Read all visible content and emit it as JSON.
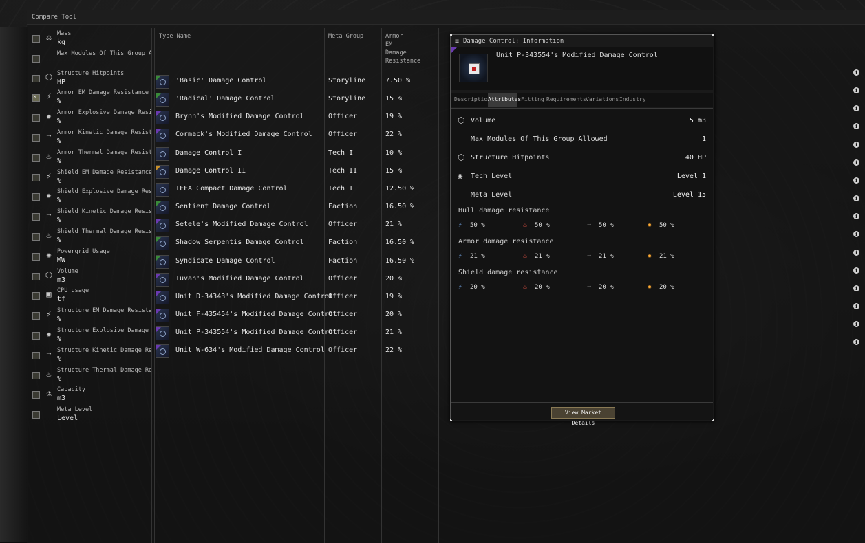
{
  "window_title": "Compare Tool",
  "attributes": [
    {
      "name": "Mass",
      "unit": "kg",
      "icon": "mass-icon",
      "glyph": "⚖",
      "checked": false
    },
    {
      "name": "Max Modules Of This Group Allowed",
      "unit": "",
      "icon": "none",
      "glyph": "",
      "checked": false
    },
    {
      "name": "Structure Hitpoints",
      "unit": "HP",
      "icon": "structure-cube-icon",
      "glyph": "⬡",
      "checked": false
    },
    {
      "name": "Armor EM Damage Resistance",
      "unit": "%",
      "icon": "em-resist-icon",
      "glyph": "⚡",
      "checked": true
    },
    {
      "name": "Armor Explosive Damage Resista",
      "unit": "%",
      "icon": "explosive-resist-icon",
      "glyph": "✹",
      "checked": false
    },
    {
      "name": "Armor Kinetic Damage Resistance",
      "unit": "%",
      "icon": "kinetic-resist-icon",
      "glyph": "➝",
      "checked": false
    },
    {
      "name": "Armor Thermal Damage Resistar",
      "unit": "%",
      "icon": "thermal-resist-icon",
      "glyph": "♨",
      "checked": false
    },
    {
      "name": "Shield EM Damage Resistance",
      "unit": "%",
      "icon": "em-resist-icon",
      "glyph": "⚡",
      "checked": false
    },
    {
      "name": "Shield Explosive Damage Resista",
      "unit": "%",
      "icon": "explosive-resist-icon",
      "glyph": "✹",
      "checked": false
    },
    {
      "name": "Shield Kinetic Damage Resistance",
      "unit": "%",
      "icon": "kinetic-resist-icon",
      "glyph": "➝",
      "checked": false
    },
    {
      "name": "Shield Thermal Damage Resistar",
      "unit": "%",
      "icon": "thermal-resist-icon",
      "glyph": "♨",
      "checked": false
    },
    {
      "name": "Powergrid Usage",
      "unit": "MW",
      "icon": "powergrid-icon",
      "glyph": "✺",
      "checked": false
    },
    {
      "name": "Volume",
      "unit": "m3",
      "icon": "volume-cube-icon",
      "glyph": "⬡",
      "checked": false
    },
    {
      "name": "CPU usage",
      "unit": "tf",
      "icon": "cpu-icon",
      "glyph": "▣",
      "checked": false
    },
    {
      "name": "Structure EM Damage Resistance",
      "unit": "%",
      "icon": "em-resist-icon",
      "glyph": "⚡",
      "checked": false
    },
    {
      "name": "Structure Explosive Damage Resi",
      "unit": "%",
      "icon": "explosive-resist-icon",
      "glyph": "✹",
      "checked": false
    },
    {
      "name": "Structure Kinetic Damage Resist",
      "unit": "%",
      "icon": "kinetic-resist-icon",
      "glyph": "➝",
      "checked": false
    },
    {
      "name": "Structure Thermal Damage Resis",
      "unit": "%",
      "icon": "thermal-resist-icon",
      "glyph": "♨",
      "checked": false
    },
    {
      "name": "Capacity",
      "unit": "m3",
      "icon": "capacity-icon",
      "glyph": "⚗",
      "checked": false
    },
    {
      "name": "Meta Level",
      "unit": "Level",
      "icon": "none",
      "glyph": "",
      "checked": false
    }
  ],
  "columns": {
    "type_name": "Type Name",
    "meta_group": "Meta Group",
    "armor_em": [
      "Armor",
      "EM",
      "Damage",
      "Resistance"
    ]
  },
  "items": [
    {
      "name": "'Basic' Damage Control",
      "meta": "Storyline",
      "value": "7.50 %",
      "tag": "#3a8a3a"
    },
    {
      "name": "'Radical' Damage Control",
      "meta": "Storyline",
      "value": "15 %",
      "tag": "#3a8a3a"
    },
    {
      "name": "Brynn's Modified Damage Control",
      "meta": "Officer",
      "value": "19 %",
      "tag": "#6a3ab0"
    },
    {
      "name": "Cormack's Modified Damage Control",
      "meta": "Officer",
      "value": "22 %",
      "tag": "#6a3ab0"
    },
    {
      "name": "Damage Control I",
      "meta": "Tech I",
      "value": "10 %",
      "tag": ""
    },
    {
      "name": "Damage Control II",
      "meta": "Tech II",
      "value": "15 %",
      "tag": "#c8902a"
    },
    {
      "name": "IFFA Compact Damage Control",
      "meta": "Tech I",
      "value": "12.50 %",
      "tag": ""
    },
    {
      "name": "Sentient Damage Control",
      "meta": "Faction",
      "value": "16.50 %",
      "tag": "#3a8a3a"
    },
    {
      "name": "Setele's Modified Damage Control",
      "meta": "Officer",
      "value": "21 %",
      "tag": "#6a3ab0"
    },
    {
      "name": "Shadow Serpentis Damage Control",
      "meta": "Faction",
      "value": "16.50 %",
      "tag": "#3a8a3a"
    },
    {
      "name": "Syndicate Damage Control",
      "meta": "Faction",
      "value": "16.50 %",
      "tag": "#3a8a3a"
    },
    {
      "name": "Tuvan's Modified Damage Control",
      "meta": "Officer",
      "value": "20 %",
      "tag": "#6a3ab0"
    },
    {
      "name": "Unit D-34343's Modified Damage Control",
      "meta": "Officer",
      "value": "19 %",
      "tag": "#6a3ab0"
    },
    {
      "name": "Unit F-435454's Modified Damage Control",
      "meta": "Officer",
      "value": "20 %",
      "tag": "#6a3ab0"
    },
    {
      "name": "Unit P-343554's Modified Damage Control",
      "meta": "Officer",
      "value": "21 %",
      "tag": "#6a3ab0"
    },
    {
      "name": "Unit W-634's Modified Damage Control",
      "meta": "Officer",
      "value": "22 %",
      "tag": "#6a3ab0"
    }
  ],
  "info_icon_glyph": "i",
  "info_window": {
    "title": "Damage Control: Information",
    "item_name": "Unit P-343554's Modified Damage Control",
    "tabs": [
      "Description",
      "Attributes",
      "Fitting",
      "Requirements",
      "Variations",
      "Industry"
    ],
    "active_tab": "Attributes",
    "attributes": [
      {
        "label": "Volume",
        "value": "5 m3",
        "icon": "volume-cube-icon",
        "glyph": "⬡"
      },
      {
        "label": "Max Modules Of This Group Allowed",
        "value": "1",
        "icon": "none",
        "glyph": ""
      },
      {
        "label": "Structure Hitpoints",
        "value": "40 HP",
        "icon": "structure-cube-icon",
        "glyph": "⬡"
      },
      {
        "label": "Tech Level",
        "value": "Level 1",
        "icon": "tech-level-icon",
        "glyph": "◉"
      },
      {
        "label": "Meta Level",
        "value": "Level 15",
        "icon": "none",
        "glyph": ""
      }
    ],
    "resist_sections": [
      {
        "title": "Hull damage resistance",
        "values": [
          "50 %",
          "50 %",
          "50 %",
          "50 %"
        ]
      },
      {
        "title": "Armor damage resistance",
        "values": [
          "21 %",
          "21 %",
          "21 %",
          "21 %"
        ]
      },
      {
        "title": "Shield damage resistance",
        "values": [
          "20 %",
          "20 %",
          "20 %",
          "20 %"
        ]
      }
    ],
    "resist_glyphs": [
      "⚡",
      "♨",
      "➝",
      "✹"
    ],
    "resist_colors": [
      "#7fb8ff",
      "#ff5a4a",
      "#cccccc",
      "#ffaa33"
    ],
    "market_button": "View Market Details"
  }
}
